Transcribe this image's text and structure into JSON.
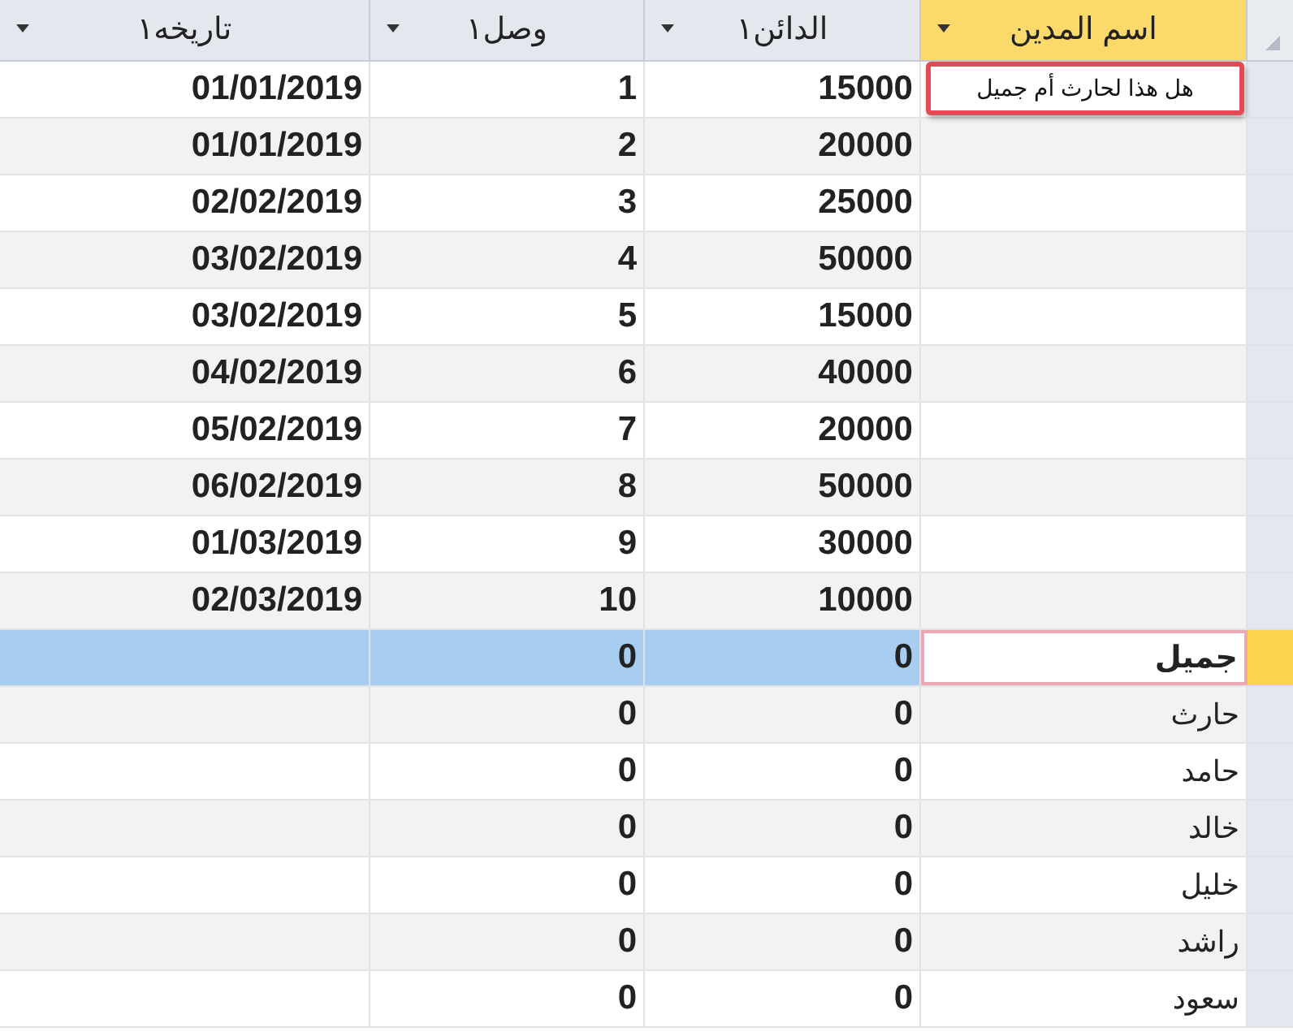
{
  "columns": [
    {
      "label": "اسم المدين",
      "selected": true
    },
    {
      "label": "الدائن١",
      "selected": false
    },
    {
      "label": "وصل١",
      "selected": false
    },
    {
      "label": "تاريخه١",
      "selected": false
    }
  ],
  "tooltip": "هل هذا لحارث أم جميل",
  "rows": [
    {
      "name": "",
      "credit": "15000",
      "receipt": "1",
      "date": "01/01/2019",
      "selected": false
    },
    {
      "name": "",
      "credit": "20000",
      "receipt": "2",
      "date": "01/01/2019",
      "selected": false
    },
    {
      "name": "",
      "credit": "25000",
      "receipt": "3",
      "date": "02/02/2019",
      "selected": false
    },
    {
      "name": "",
      "credit": "50000",
      "receipt": "4",
      "date": "03/02/2019",
      "selected": false
    },
    {
      "name": "",
      "credit": "15000",
      "receipt": "5",
      "date": "03/02/2019",
      "selected": false
    },
    {
      "name": "",
      "credit": "40000",
      "receipt": "6",
      "date": "04/02/2019",
      "selected": false
    },
    {
      "name": "",
      "credit": "20000",
      "receipt": "7",
      "date": "05/02/2019",
      "selected": false
    },
    {
      "name": "",
      "credit": "50000",
      "receipt": "8",
      "date": "06/02/2019",
      "selected": false
    },
    {
      "name": "",
      "credit": "30000",
      "receipt": "9",
      "date": "01/03/2019",
      "selected": false
    },
    {
      "name": "",
      "credit": "10000",
      "receipt": "10",
      "date": "02/03/2019",
      "selected": false
    },
    {
      "name": "جميل",
      "credit": "0",
      "receipt": "0",
      "date": "",
      "selected": true
    },
    {
      "name": "حارث",
      "credit": "0",
      "receipt": "0",
      "date": "",
      "selected": false
    },
    {
      "name": "حامد",
      "credit": "0",
      "receipt": "0",
      "date": "",
      "selected": false
    },
    {
      "name": "خالد",
      "credit": "0",
      "receipt": "0",
      "date": "",
      "selected": false
    },
    {
      "name": "خليل",
      "credit": "0",
      "receipt": "0",
      "date": "",
      "selected": false
    },
    {
      "name": "راشد",
      "credit": "0",
      "receipt": "0",
      "date": "",
      "selected": false
    },
    {
      "name": "سعود",
      "credit": "0",
      "receipt": "0",
      "date": "",
      "selected": false
    }
  ]
}
